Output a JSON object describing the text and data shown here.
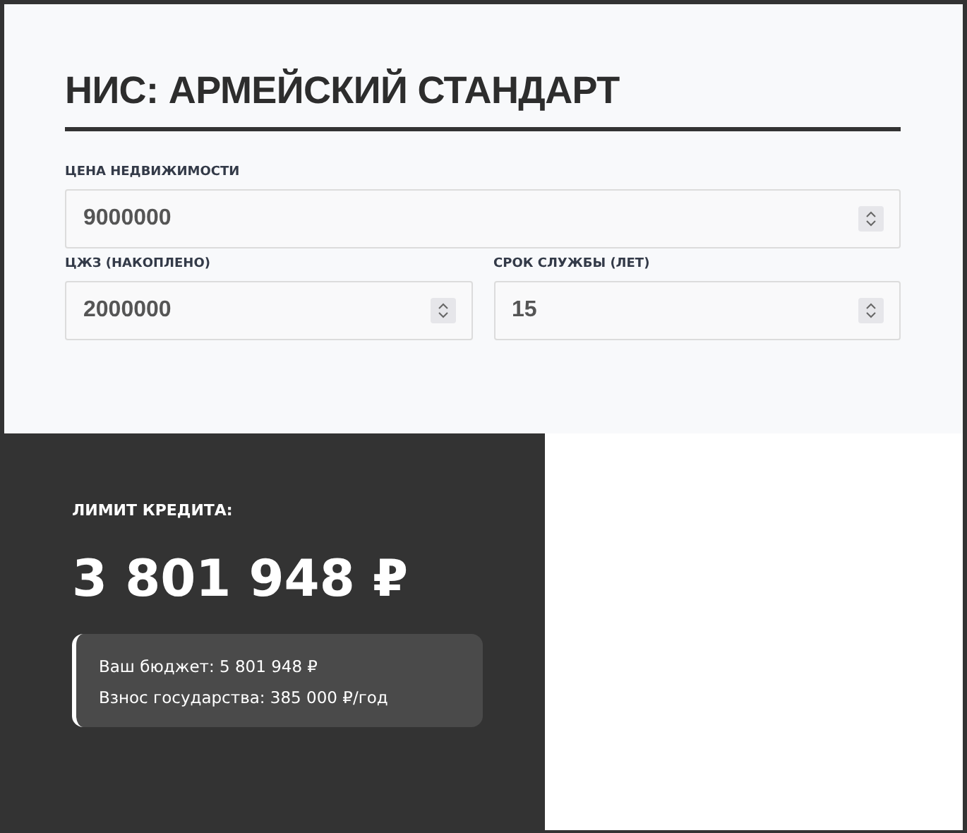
{
  "title": "НИС: АРМЕЙСКИЙ СТАНДАРТ",
  "fields": [
    {
      "label": "ЦЕНА НЕДВИЖИМОСТИ",
      "value": "9000000",
      "wide": true
    },
    {
      "label": "ЦЖЗ (НАКОПЛЕНО)",
      "value": "2000000",
      "wide": false
    },
    {
      "label": "СРОК СЛУЖБЫ (ЛЕТ)",
      "value": "15",
      "wide": false
    }
  ],
  "result": {
    "label": "ЛИМИТ КРЕДИТА:",
    "amount": "3 801 948 ₽",
    "details": [
      "Ваш бюджет: 5 801 948 ₽",
      "Взнос государства: 385 000 ₽/год"
    ]
  }
}
